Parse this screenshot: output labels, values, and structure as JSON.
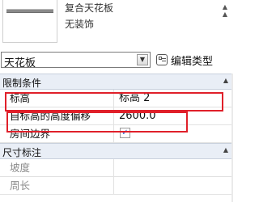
{
  "preview": {
    "type_name": "复合天花板",
    "finish": "无装饰",
    "scroll_glyph": "▲"
  },
  "selector": {
    "value": "天花板",
    "dropdown_glyph": "▼",
    "edit_type_label": "编辑类型"
  },
  "groups": [
    {
      "title": "限制条件",
      "caret": "▲"
    },
    {
      "title": "尺寸标注",
      "caret": "▲"
    }
  ],
  "constraints": {
    "level_label": "标高",
    "level_value": "标高 2",
    "offset_label": "自标高的高度偏移",
    "offset_value": "2600.0",
    "room_bound_label": "房间边界",
    "room_bound_checked": "✓"
  },
  "dimensions": {
    "slope_label": "坡度",
    "perimeter_label": "周长"
  },
  "colors": {
    "highlight": "#e0202a",
    "group_bg": "#e9eef6"
  }
}
